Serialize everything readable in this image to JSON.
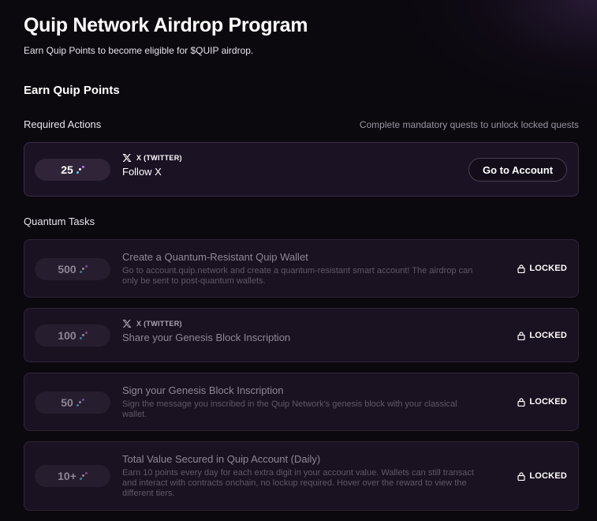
{
  "header": {
    "title": "Quip Network Airdrop Program",
    "subtitle": "Earn Quip Points to become eligible for $QUIP airdrop."
  },
  "section_title": "Earn Quip Points",
  "required": {
    "title": "Required Actions",
    "hint": "Complete mandatory quests to unlock locked quests",
    "tasks": [
      {
        "points": "25",
        "platform": "X (TWITTER)",
        "name": "Follow X",
        "action_label": "Go to Account"
      }
    ]
  },
  "quantum": {
    "title": "Quantum Tasks",
    "locked_label": "LOCKED",
    "tasks": [
      {
        "points": "500",
        "name": "Create a Quantum-Resistant Quip Wallet",
        "description": "Go to account.quip.network and create a quantum-resistant smart account! The airdrop can only be sent to post-quantum wallets."
      },
      {
        "points": "100",
        "platform": "X (TWITTER)",
        "name": "Share your Genesis Block Inscription"
      },
      {
        "points": "50",
        "name": "Sign your Genesis Block Inscription",
        "description": "Sign the message you inscribed in the Quip Network's genesis block with your classical wallet."
      },
      {
        "points": "10+",
        "name": "Total Value Secured in Quip Account (Daily)",
        "description": "Earn 10 points every day for each extra digit in your account value. Wallets can still transact and interact with contracts onchain, no lockup required. Hover over the reward to view the different tiers."
      }
    ]
  },
  "icons": {
    "points": "quip-points-icon",
    "platform": "x-logo-icon",
    "locked": "lock-icon"
  }
}
